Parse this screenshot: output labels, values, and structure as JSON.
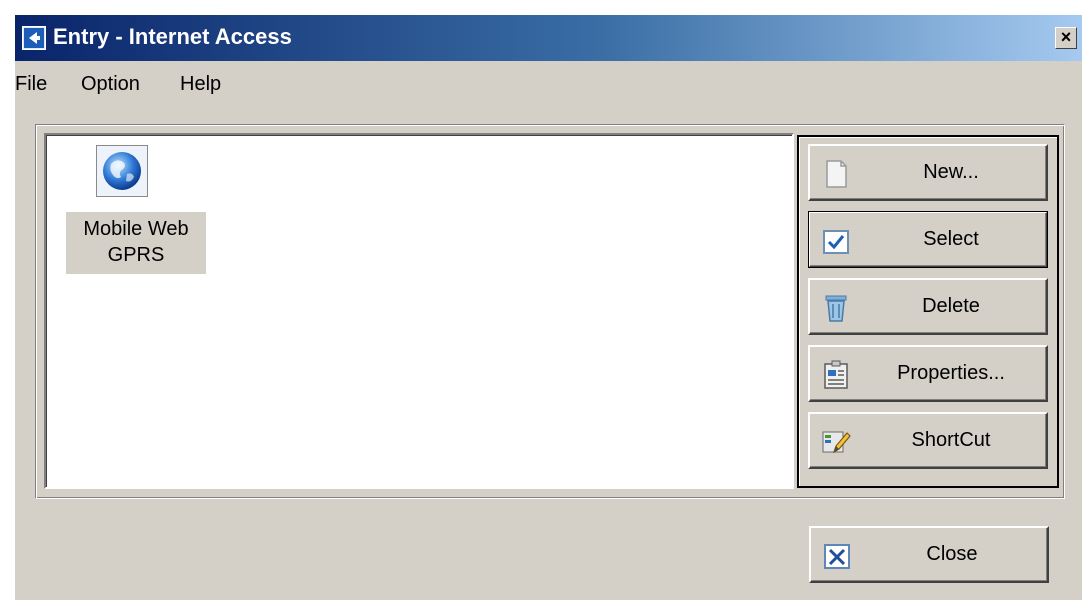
{
  "window": {
    "title": "Entry - Internet Access",
    "close_glyph": "×"
  },
  "menu": [
    "File",
    "Option",
    "Help"
  ],
  "entries": [
    {
      "label_line1": "Mobile Web",
      "label_line2": "GPRS",
      "icon": "globe-icon"
    }
  ],
  "buttons": {
    "new": {
      "label": "New...",
      "icon": "document-icon"
    },
    "select": {
      "label": "Select",
      "icon": "checkbox-icon"
    },
    "delete": {
      "label": "Delete",
      "icon": "trash-icon"
    },
    "properties": {
      "label": "Properties...",
      "icon": "properties-icon"
    },
    "shortcut": {
      "label": "ShortCut",
      "icon": "pencil-icon"
    },
    "close": {
      "label": "Close",
      "icon": "close-icon"
    }
  },
  "colors": {
    "title_gradient_start": "#0a246a",
    "title_gradient_end": "#a6caf0",
    "face": "#d4d0c8"
  }
}
